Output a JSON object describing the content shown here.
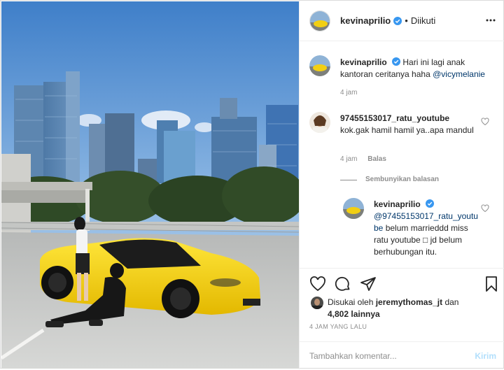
{
  "post": {
    "username": "kevinaprilio",
    "separator": "•",
    "follow_state": "Diikuti",
    "caption_user": "kevinaprilio",
    "caption_text": "Hari ini lagi anak kantoran ceritanya haha",
    "caption_mention": "@vicymelanie",
    "caption_time": "4 jam"
  },
  "comments": [
    {
      "user": "97455153017_ratu_youtube",
      "text": "kok.gak hamil hamil ya..apa mandul",
      "time": "4 jam",
      "reply_label": "Balas",
      "hide_replies": "Sembunyikan balasan"
    }
  ],
  "reply": {
    "user": "kevinaprilio",
    "mention": "@97455153017_ratu_youtube",
    "text": "belum marrieddd miss ratu youtube □ jd belum berhubungan itu."
  },
  "likes": {
    "prefix": "Disukai oleh",
    "user": "jeremythomas_jt",
    "mid": "dan",
    "count": "4,802 lainnya"
  },
  "timestamp": "4 JAM YANG LALU",
  "add_comment": {
    "placeholder": "Tambahkan komentar...",
    "post_label": "Kirim"
  },
  "icons": {
    "verified": "verified-badge-icon",
    "more": "more-options-icon",
    "like": "heart-icon",
    "comment": "comment-bubble-icon",
    "share": "paper-plane-icon",
    "save": "bookmark-icon"
  },
  "colors": {
    "verified_blue": "#3897f0",
    "link": "#00376b",
    "post_button": "#b2dffc",
    "car_yellow": "#f5d10a"
  }
}
